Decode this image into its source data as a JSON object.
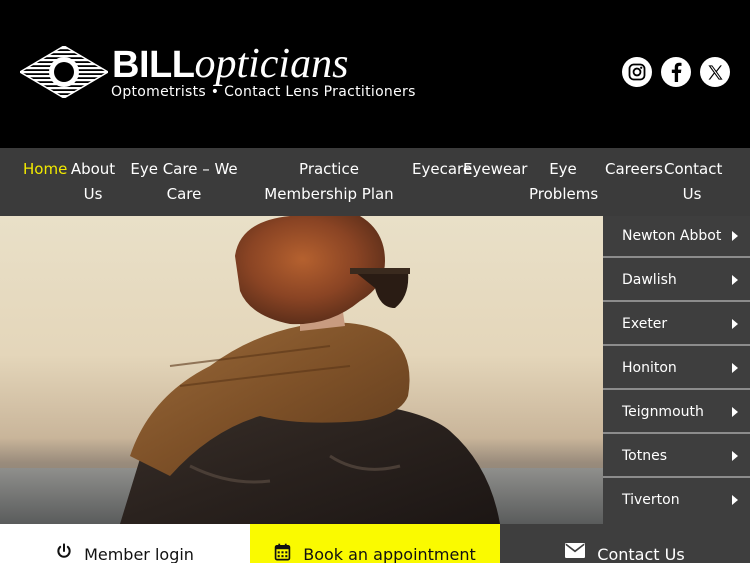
{
  "brand": {
    "name_bold": "BILL",
    "name_italic": "opticians",
    "tagline": "Optometrists • Contact Lens Practitioners"
  },
  "social": [
    {
      "name": "instagram",
      "icon": "instagram-icon"
    },
    {
      "name": "facebook",
      "icon": "facebook-icon"
    },
    {
      "name": "x",
      "icon": "x-icon"
    }
  ],
  "nav": {
    "items": [
      {
        "label": "Home",
        "active": true
      },
      {
        "label": "About Us"
      },
      {
        "label": "Eye Care – We Care"
      },
      {
        "label": "Practice Membership Plan"
      },
      {
        "label": "Eyecare"
      },
      {
        "label": "Eyewear"
      },
      {
        "label": "Eye Problems"
      },
      {
        "label": "Careers"
      },
      {
        "label": "Contact Us"
      }
    ]
  },
  "locations": [
    {
      "label": "Newton Abbot"
    },
    {
      "label": "Dawlish"
    },
    {
      "label": "Exeter"
    },
    {
      "label": "Honiton"
    },
    {
      "label": "Teignmouth"
    },
    {
      "label": "Totnes"
    },
    {
      "label": "Tiverton"
    }
  ],
  "cta": {
    "member": "Member login",
    "book": "Book an appointment",
    "contact": "Contact Us"
  },
  "colors": {
    "accent_yellow": "#f2ea00",
    "nav_bg": "#3b3b3b",
    "button_yellow": "#fafa00"
  }
}
